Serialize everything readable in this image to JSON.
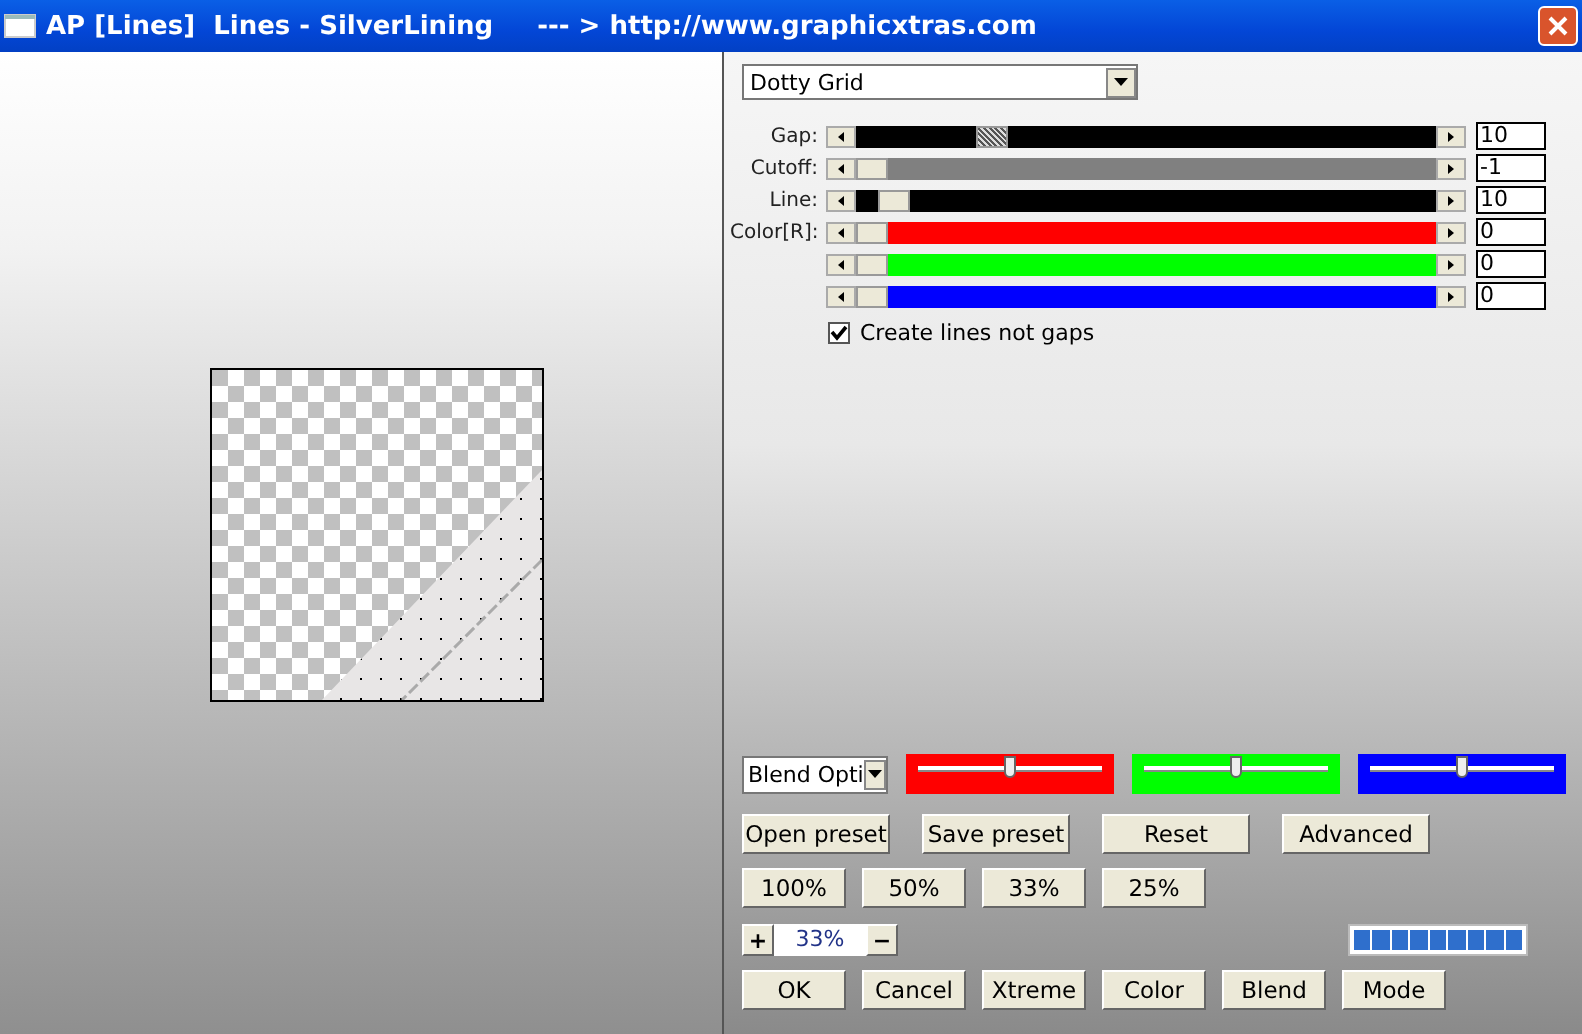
{
  "window": {
    "title": "AP [Lines]  Lines - SilverLining",
    "subtitle": "--- > http://www.graphicxtras.com"
  },
  "preset": {
    "value": "Dotty Grid"
  },
  "sliders": [
    {
      "label": "Gap:",
      "value": "10",
      "level": 0.22,
      "color": "#000000",
      "focused": true
    },
    {
      "label": "Cutoff:",
      "value": "-1",
      "level": 0,
      "color": "#808080",
      "focused": false
    },
    {
      "label": "Line:",
      "value": "10",
      "level": 0.04,
      "color": "#000000",
      "focused": false
    },
    {
      "label": "Color[R]:",
      "value": "0",
      "level": 0,
      "color": "#ff0000",
      "focused": false
    },
    {
      "value": "0",
      "level": 0,
      "color": "#00ff00",
      "focused": false
    },
    {
      "value": "0",
      "level": 0,
      "color": "#0000ff",
      "focused": false
    }
  ],
  "create_lines": {
    "label": "Create lines not gaps",
    "checked": true
  },
  "blend": {
    "value": "Blend Opti"
  },
  "color_sliders": [
    {
      "color": "#ff0000",
      "level": 0.5
    },
    {
      "color": "#00ff00",
      "level": 0.5
    },
    {
      "color": "#0000ff",
      "level": 0.5
    }
  ],
  "preset_buttons": [
    "Open preset",
    "Save preset",
    "Reset",
    "Advanced"
  ],
  "zoom_buttons": [
    "100%",
    "50%",
    "33%",
    "25%"
  ],
  "zoom": {
    "plus": "+",
    "value": "33%",
    "minus": "−"
  },
  "progress": {
    "level": 1
  },
  "buttons": [
    "OK",
    "Cancel",
    "Xtreme",
    "Color",
    "Blend",
    "Mode"
  ]
}
